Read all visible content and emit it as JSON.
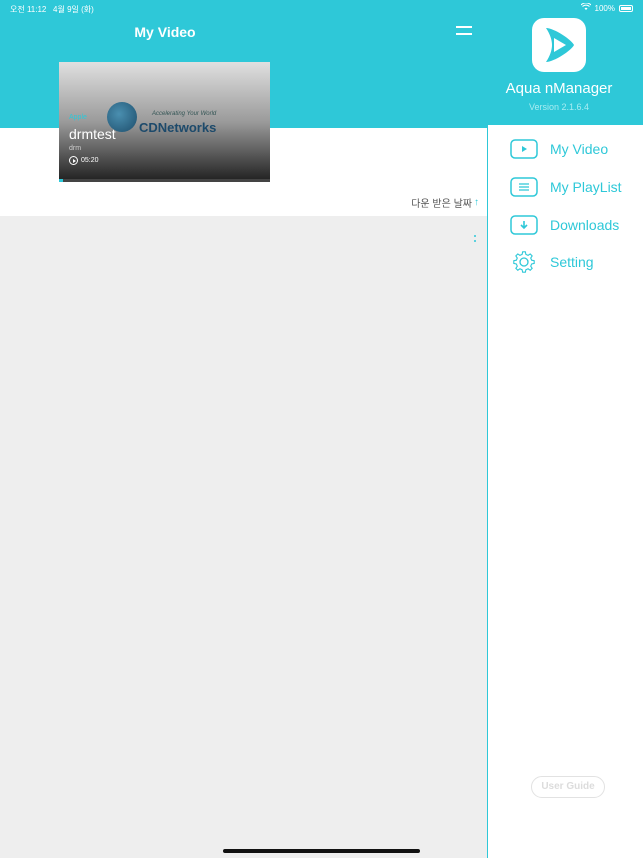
{
  "status_bar": {
    "time": "오전 11:12",
    "date": "4월 9일 (화)",
    "battery": "100%"
  },
  "header": {
    "title": "My Video"
  },
  "video_card": {
    "category": "Apple",
    "title": "drmtest",
    "subtitle": "drm",
    "duration": "05:20",
    "thumbnail_brand": "CDNetworks",
    "thumbnail_tagline": "Accelerating Your World",
    "progress": 0.02
  },
  "sort": {
    "label": "다운 받은 날짜",
    "direction_icon": "arrow-up"
  },
  "sidebar": {
    "app_name": "Aqua nManager",
    "version": "Version 2.1.6.4",
    "items": [
      {
        "label": "My Video",
        "icon": "play-box-icon"
      },
      {
        "label": "My PlayList",
        "icon": "list-box-icon"
      },
      {
        "label": "Downloads",
        "icon": "download-box-icon"
      },
      {
        "label": "Setting",
        "icon": "gear-icon"
      }
    ],
    "user_guide_label": "User Guide"
  },
  "colors": {
    "accent": "#2ec8d8",
    "background": "#eeeeee"
  }
}
